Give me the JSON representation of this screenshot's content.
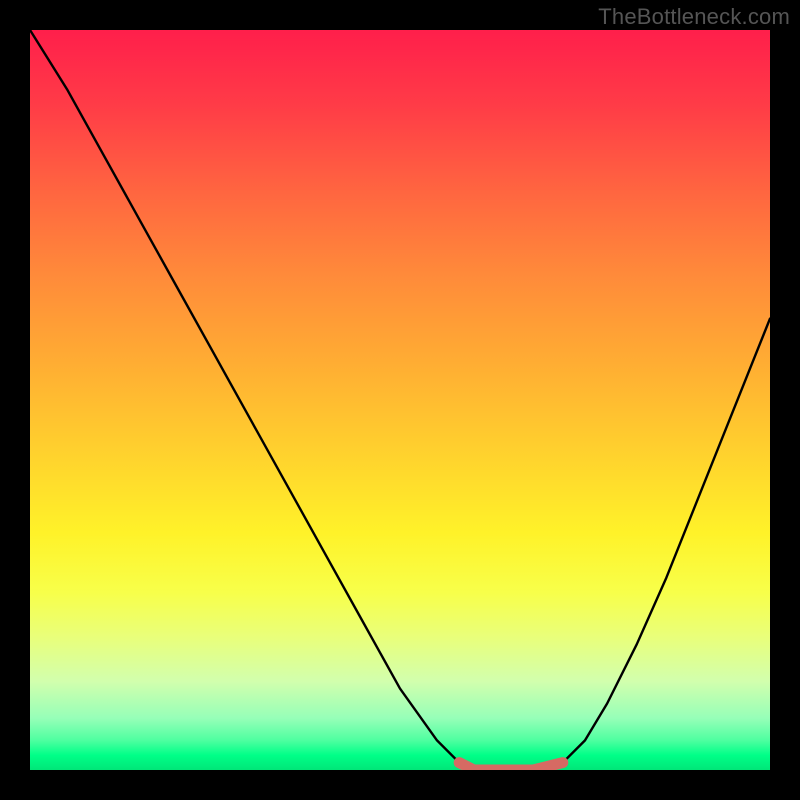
{
  "watermark": "TheBottleneck.com",
  "chart_data": {
    "type": "line",
    "title": "",
    "xlabel": "",
    "ylabel": "",
    "xlim": [
      0,
      1
    ],
    "ylim": [
      0,
      1
    ],
    "series": [
      {
        "name": "bottleneck-curve",
        "x": [
          0.0,
          0.05,
          0.1,
          0.15,
          0.2,
          0.25,
          0.3,
          0.35,
          0.4,
          0.45,
          0.5,
          0.55,
          0.58,
          0.6,
          0.64,
          0.68,
          0.72,
          0.75,
          0.78,
          0.82,
          0.86,
          0.9,
          0.94,
          0.98,
          1.0
        ],
        "values": [
          1.0,
          0.92,
          0.83,
          0.74,
          0.65,
          0.56,
          0.47,
          0.38,
          0.29,
          0.2,
          0.11,
          0.04,
          0.01,
          0.0,
          0.0,
          0.0,
          0.01,
          0.04,
          0.09,
          0.17,
          0.26,
          0.36,
          0.46,
          0.56,
          0.61
        ]
      },
      {
        "name": "optimal-band",
        "x": [
          0.58,
          0.6,
          0.64,
          0.68,
          0.72
        ],
        "values": [
          0.01,
          0.0,
          0.0,
          0.0,
          0.01
        ]
      }
    ],
    "colors": {
      "curve": "#000000",
      "optimal": "#d66a63"
    }
  }
}
